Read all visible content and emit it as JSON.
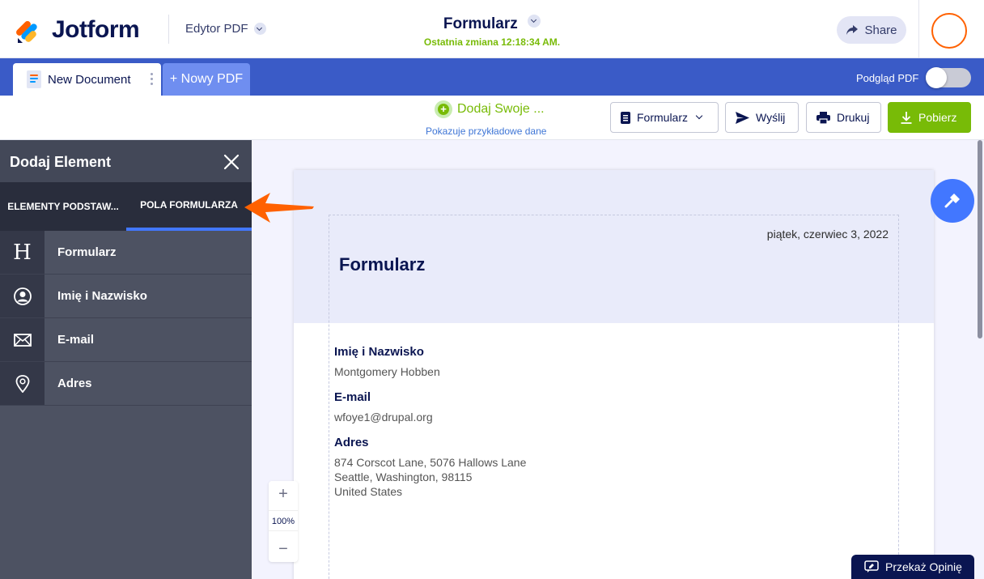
{
  "header": {
    "logo_text": "Jotform",
    "editor_label": "Edytor PDF",
    "doc_title": "Formularz",
    "last_change": "Ostatnia zmiana 12:18:34 AM.",
    "share_label": "Share"
  },
  "tabs": {
    "document_tab": "New Document",
    "new_pdf": "+ Nowy PDF",
    "preview_label": "Podgląd PDF",
    "preview_enabled": false
  },
  "toolbar": {
    "add_your": "Dodaj Swoje ...",
    "sample_data": "Pokazuje przykładowe dane",
    "form_label": "Formularz",
    "send_label": "Wyślij",
    "print_label": "Drukuj",
    "download_label": "Pobierz"
  },
  "panel": {
    "title": "Dodaj Element",
    "tab_basic": "ELEMENTY PODSTAW...",
    "tab_fields": "POLA FORMULARZA",
    "items": [
      {
        "label": "Formularz",
        "icon": "heading-icon"
      },
      {
        "label": "Imię i Nazwisko",
        "icon": "user-icon"
      },
      {
        "label": "E-mail",
        "icon": "envelope-icon"
      },
      {
        "label": "Adres",
        "icon": "location-pin-icon"
      }
    ]
  },
  "document": {
    "date": "piątek, czerwiec 3, 2022",
    "title": "Formularz",
    "fields": [
      {
        "label": "Imię i Nazwisko",
        "value": [
          "Montgomery Hobben"
        ]
      },
      {
        "label": "E-mail",
        "value": [
          "wfoye1@drupal.org"
        ]
      },
      {
        "label": "Adres",
        "value": [
          "874 Corscot Lane, 5076 Hallows Lane",
          "Seattle, Washington, 98115",
          "United States"
        ]
      }
    ]
  },
  "zoom": {
    "plus": "+",
    "level": "100%",
    "minus": "−"
  },
  "feedback_label": "Przekaż Opinię",
  "colors": {
    "brand_blue": "#3a5bc7",
    "accent_green": "#78bb07",
    "panel_dark": "#4d5262",
    "active_tab_underline": "#4277ff",
    "arrow_orange": "#ff6100"
  }
}
